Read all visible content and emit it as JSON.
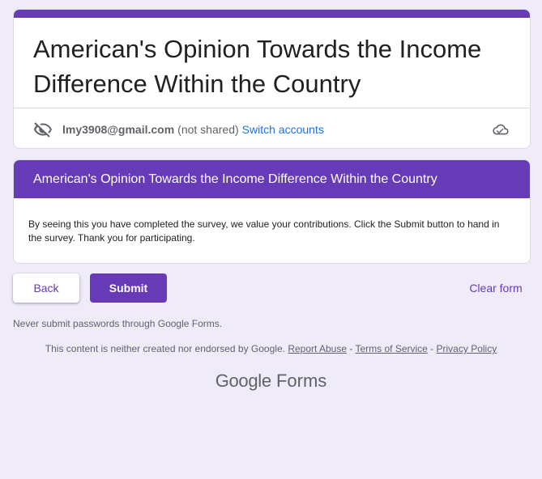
{
  "form": {
    "title": "American's Opinion Towards the Income Difference Within the Country",
    "accent": "#673ab7"
  },
  "account": {
    "icon": "eye-off-icon",
    "email": "lmy3908@gmail.com",
    "not_shared": "(not shared)",
    "switch_label": "Switch accounts",
    "cloud_icon": "cloud-saved-icon"
  },
  "section": {
    "header": "American's Opinion Towards the Income Difference Within the Country",
    "description": "By seeing this you have completed the survey, we value your contributions. Click the Submit button to hand in the survey. Thank you for participating."
  },
  "actions": {
    "back_label": "Back",
    "submit_label": "Submit",
    "clear_label": "Clear form"
  },
  "footer": {
    "never_submit": "Never submit passwords through Google Forms.",
    "disclaimer": "This content is neither created nor endorsed by Google.",
    "report_abuse": "Report Abuse",
    "sep1": " - ",
    "terms": "Terms of Service",
    "sep2": " - ",
    "privacy": "Privacy Policy",
    "logo_google": "Google",
    "logo_forms": "Forms"
  }
}
